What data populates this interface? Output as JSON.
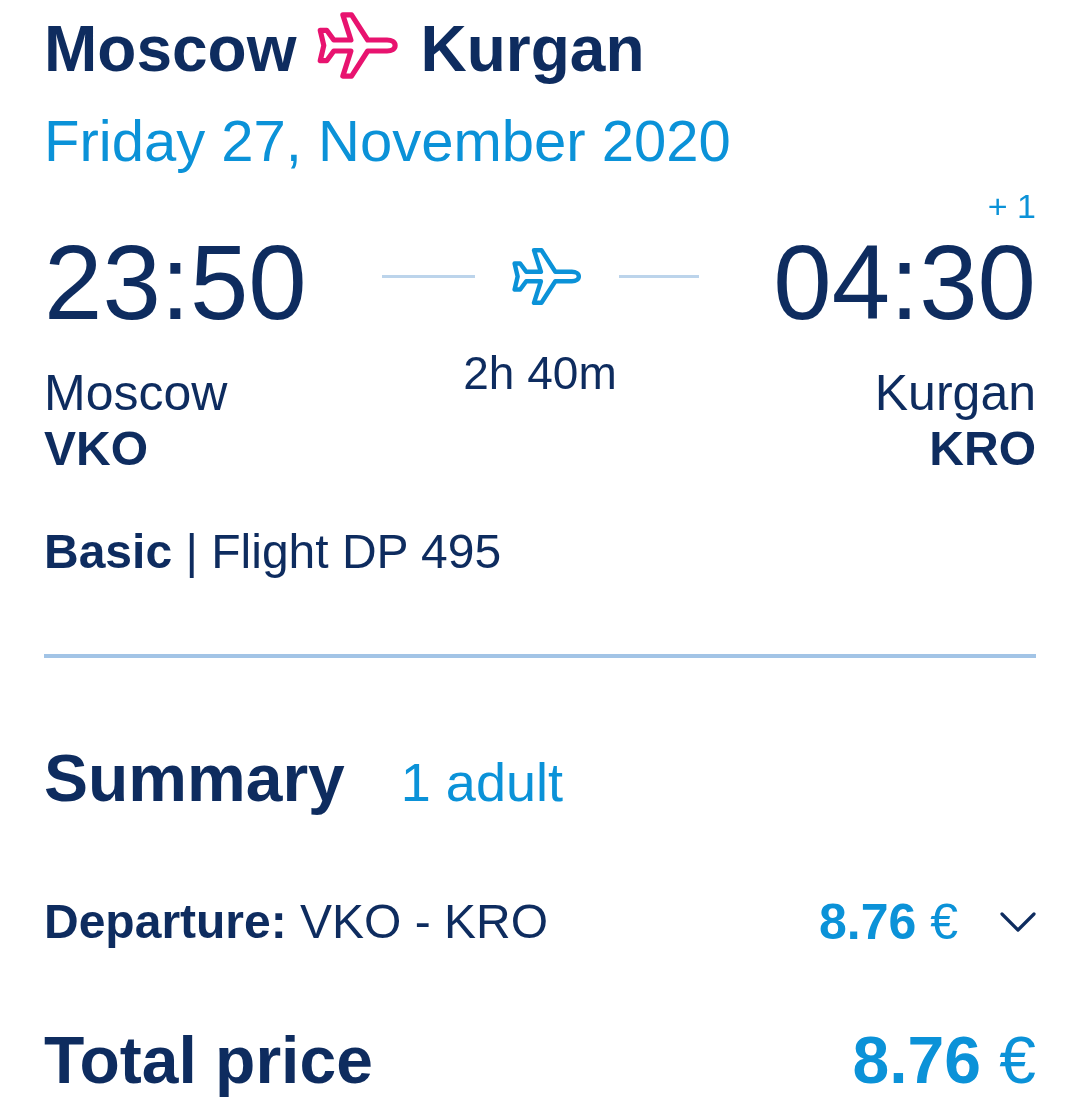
{
  "header": {
    "origin": "Moscow",
    "destination": "Kurgan"
  },
  "date": "Friday 27, November 2020",
  "flight": {
    "departure": {
      "time": "23:50",
      "city": "Moscow",
      "code": "VKO"
    },
    "duration": "2h 40m",
    "arrival": {
      "day_offset": "+ 1",
      "time": "04:30",
      "city": "Kurgan",
      "code": "KRO"
    }
  },
  "fare": "**Basic** | Flight DP 495",
  "summary": {
    "title": "Summary",
    "passengers": "1 adult",
    "legs": [
      {
        "label": "**Departure:** VKO - KRO",
        "price": "**8.76** €",
        "expanded": false
      }
    ],
    "total": {
      "label": "Total price",
      "price": "**8.76** €"
    }
  }
}
